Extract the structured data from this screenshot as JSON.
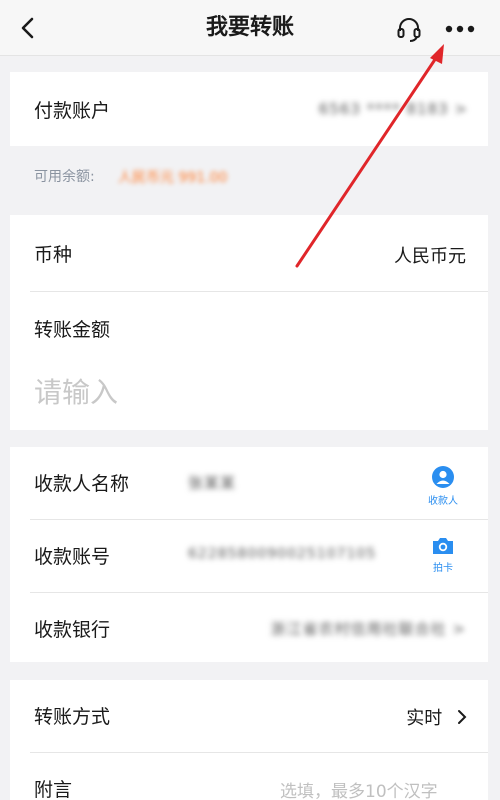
{
  "header": {
    "title": "我要转账",
    "back_icon": "chevron-left-icon",
    "support_icon": "headset-icon",
    "more_icon": "more-dots-icon"
  },
  "payer": {
    "label": "付款账户",
    "account_masked": "6563 **** 8183 >",
    "balance_label": "可用余额:",
    "balance_value": "人民币元 991.00"
  },
  "currency": {
    "label": "币种",
    "value": "人民币元"
  },
  "amount": {
    "label": "转账金额",
    "placeholder": "请输入"
  },
  "payee": {
    "name_label": "收款人名称",
    "name_value": "张某某",
    "payee_button_label": "收款人",
    "account_label": "收款账号",
    "account_value": "6228580090025107105",
    "scan_button_label": "拍卡",
    "bank_label": "收款银行",
    "bank_value": "浙江省农村信用社联合社 >"
  },
  "transfer": {
    "method_label": "转账方式",
    "method_value": "实时",
    "note_label": "附言",
    "note_placeholder": "选填，最多10个汉字"
  },
  "colors": {
    "accent_blue": "#2a8ef0",
    "balance_orange": "#ff7a2a",
    "annotation_red": "#e0262a"
  }
}
